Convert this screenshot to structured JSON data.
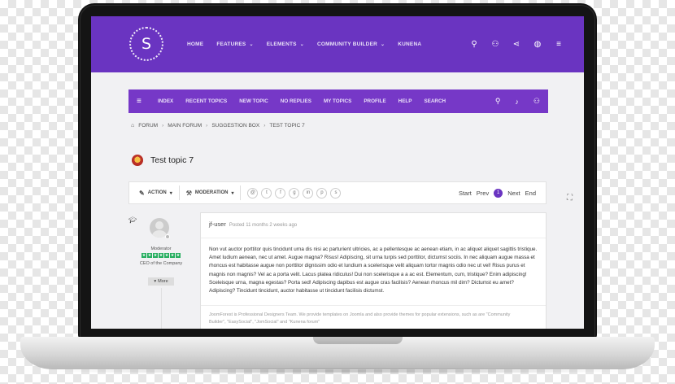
{
  "header": {
    "logo_letter": "S",
    "nav": [
      {
        "label": "HOME",
        "dropdown": false
      },
      {
        "label": "FEATURES",
        "dropdown": true
      },
      {
        "label": "ELEMENTS",
        "dropdown": true
      },
      {
        "label": "COMMUNITY BUILDER",
        "dropdown": true
      },
      {
        "label": "KUNENA",
        "dropdown": false
      }
    ],
    "icons": [
      "search-icon",
      "user-icon",
      "share-icon",
      "globe-icon",
      "menu-icon"
    ],
    "color": "#6a34c1"
  },
  "forum_bar": {
    "links": [
      "INDEX",
      "RECENT TOPICS",
      "NEW TOPIC",
      "NO REPLIES",
      "MY TOPICS",
      "PROFILE",
      "HELP",
      "SEARCH"
    ],
    "icons": [
      "search-icon",
      "microphone-icon",
      "user-icon"
    ],
    "color": "#7638c7"
  },
  "breadcrumb": [
    "FORUM",
    "MAIN FORUM",
    "SUGGESTION BOX",
    "TEST TOPIC 7"
  ],
  "topic": {
    "title": "Test topic 7"
  },
  "actions": {
    "action_label": "ACTION",
    "moderation_label": "MODERATION",
    "share_icons": [
      "email-icon",
      "twitter-icon",
      "facebook-icon",
      "google-plus-icon",
      "linkedin-icon",
      "pinterest-icon",
      "stumbleupon-icon"
    ]
  },
  "pager": {
    "start": "Start",
    "prev": "Prev",
    "current": "1",
    "next": "Next",
    "end": "End"
  },
  "post": {
    "author_role": "Moderator",
    "author_title": "CEO of the Company",
    "more_label": "More",
    "user": "jf-user",
    "time": "Posted 11 months 2 weeks ago",
    "body": "Non vut auctor porttitor quis tincidunt urna dis nisi ac parturient ultricies, ac a pellentesque ac aenean etiam, in ac aliquet aliquet sagittis tristique. Amet ludium aenean, nec ut amet. Augue magna? Risus! Adipiscing, sit urna turpis sed porttitor, dictumst sociis. In nec aliquam augue massa et rhoncus est habitasse augue non porttitor dignissim odio et lundium a scelerisque velit aliquam tortor magnis odio nec ut vel! Risus purus et magnis non magnis? Vel ac a porta velit. Lacus platea ridiculus! Dui non scelerisque a a ac est. Elementum, cum, tristique? Enim adipiscing! Sceleisque urna, magna egestas? Porta sed! Adipiscing dapibus est augue cras facilisis? Aenean rhoncus mil dim? Dictumst eu amet? Adipiscing? Tincidunt tincidunt, auctor habitasse ut tincidunt facilisis dictumst.",
    "signature": "JoomForest is Professional Designers Team. We provide templates on Joomla and also provide themes for popular extensions, such as are \"Community Builder\", \"EasySocial\", \"JomSocial\" and \"Kunena forum\"",
    "rating_stars": 7
  }
}
